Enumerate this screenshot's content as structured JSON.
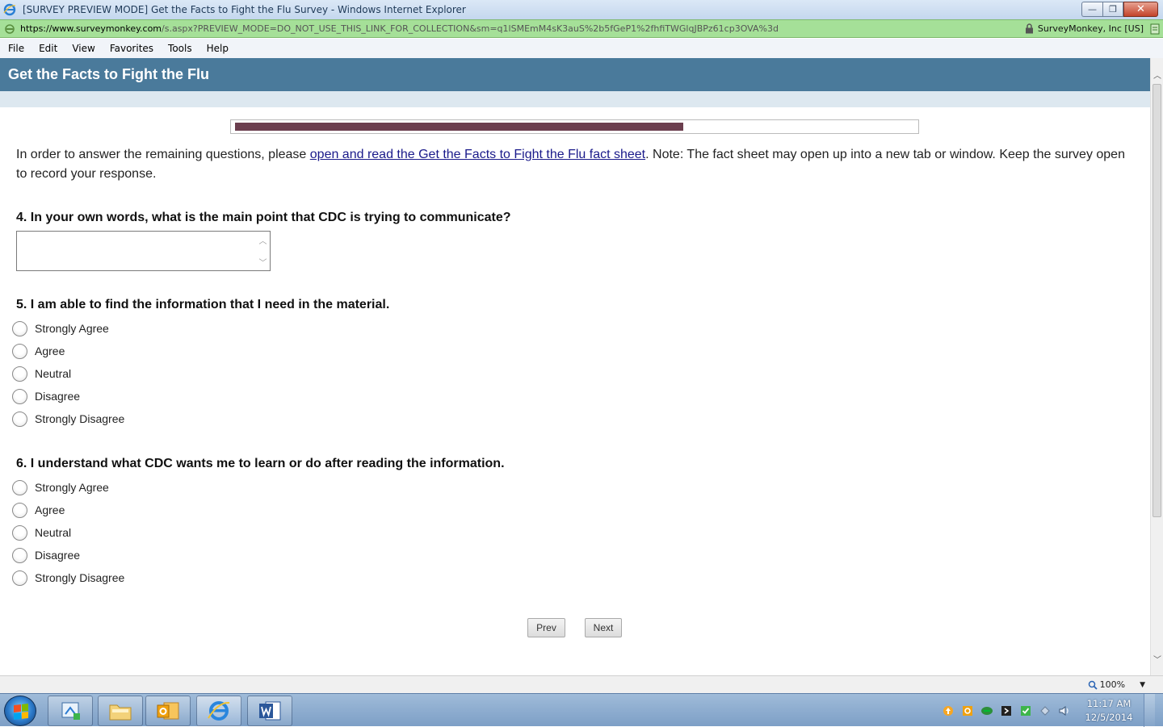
{
  "window": {
    "title": "[SURVEY PREVIEW MODE] Get the Facts to Fight the Flu Survey - Windows Internet Explorer",
    "minimize_glyph": "—",
    "maximize_glyph": "❐",
    "close_glyph": "✕"
  },
  "address": {
    "url_domain": "https://www.surveymonkey.com",
    "url_rest": "/s.aspx?PREVIEW_MODE=DO_NOT_USE_THIS_LINK_FOR_COLLECTION&sm=q1lSMEmM4sK3auS%2b5fGeP1%2fhfiTWGlqJBPz61cp3OVA%3d",
    "certificate": "SurveyMonkey, Inc [US]"
  },
  "menu": [
    "File",
    "Edit",
    "View",
    "Favorites",
    "Tools",
    "Help"
  ],
  "survey": {
    "header_title": "Get the Facts to Fight the Flu",
    "progress_fraction": 0.66,
    "intro_before": "In order to answer the remaining questions, please ",
    "intro_link": "open and read the Get the Facts to Fight the Flu fact sheet",
    "intro_after": ". Note: The fact sheet may open up into a new tab or window. Keep the survey open to record your response.",
    "questions": [
      {
        "label": "4. In your own words, what is the main point that CDC is trying to communicate?"
      },
      {
        "label": "5. I am able to find the information that I need in the material.",
        "options": [
          "Strongly Agree",
          "Agree",
          "Neutral",
          "Disagree",
          "Strongly Disagree"
        ]
      },
      {
        "label": "6. I understand what CDC wants me to learn or do after reading the information.",
        "options": [
          "Strongly Agree",
          "Agree",
          "Neutral",
          "Disagree",
          "Strongly Disagree"
        ]
      }
    ],
    "prev_label": "Prev",
    "next_label": "Next"
  },
  "statusbar": {
    "zoom": "100%"
  },
  "taskbar": {
    "clock_time": "11:17 AM",
    "clock_date": "12/5/2014"
  },
  "colors": {
    "header_bg": "#4a7a9b",
    "progress_fill": "#6b3e4e",
    "address_bg": "#a5e098",
    "link": "#1a1a8a"
  }
}
